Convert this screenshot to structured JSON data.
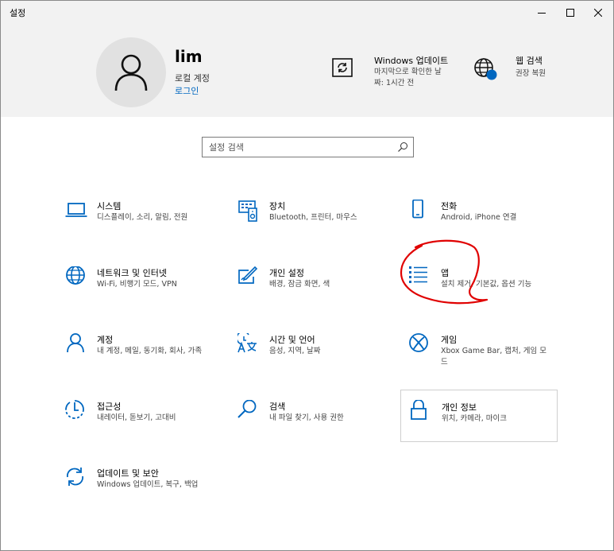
{
  "window": {
    "title": "설정",
    "controls": [
      "minimize-icon",
      "maximize-icon",
      "close-icon"
    ]
  },
  "header": {
    "user": {
      "name": "lim",
      "account_type": "로컬 계정",
      "signin_link": "로그인"
    },
    "update": {
      "title": "Windows 업데이트",
      "line1": "마지막으로 확인한 날",
      "line2": "짜: 1시간 전"
    },
    "web_search": {
      "title": "웹 검색",
      "subtitle": "권장 복원"
    }
  },
  "search": {
    "placeholder": "설정 검색",
    "value": ""
  },
  "tiles": [
    {
      "name": "시스템",
      "desc": "디스플레이, 소리, 알림, 전원",
      "icon": "laptop-icon"
    },
    {
      "name": "장치",
      "desc": "Bluetooth, 프린터, 마우스",
      "icon": "devices-icon"
    },
    {
      "name": "전화",
      "desc": "Android, iPhone 연결",
      "icon": "phone-icon"
    },
    {
      "name": "네트워크 및 인터넷",
      "desc": "Wi-Fi, 비행기 모드, VPN",
      "icon": "globe-icon"
    },
    {
      "name": "개인 설정",
      "desc": "배경, 잠금 화면, 색",
      "icon": "paint-icon"
    },
    {
      "name": "앱",
      "desc": "설치 제거, 기본값, 옵션 기능",
      "icon": "apps-list-icon"
    },
    {
      "name": "계정",
      "desc": "내 계정, 메일, 동기화, 회사, 가족",
      "icon": "person-icon"
    },
    {
      "name": "시간 및 언어",
      "desc": "음성, 지역, 날짜",
      "icon": "time-language-icon"
    },
    {
      "name": "게임",
      "desc": "Xbox Game Bar, 캡처, 게임 모드",
      "icon": "xbox-icon"
    },
    {
      "name": "접근성",
      "desc": "내레이터, 돋보기, 고대비",
      "icon": "ease-of-access-icon"
    },
    {
      "name": "검색",
      "desc": "내 파일 찾기, 사용 권한",
      "icon": "search-magnifier-icon"
    },
    {
      "name": "개인 정보",
      "desc": "위치, 카메라, 마이크",
      "icon": "lock-icon"
    },
    {
      "name": "업데이트 및 보안",
      "desc": "Windows 업데이트, 복구, 백업",
      "icon": "sync-icon"
    }
  ],
  "colors": {
    "accent": "#0067c0",
    "header_bg": "#f2f2f2",
    "annotation": "#e00000"
  }
}
